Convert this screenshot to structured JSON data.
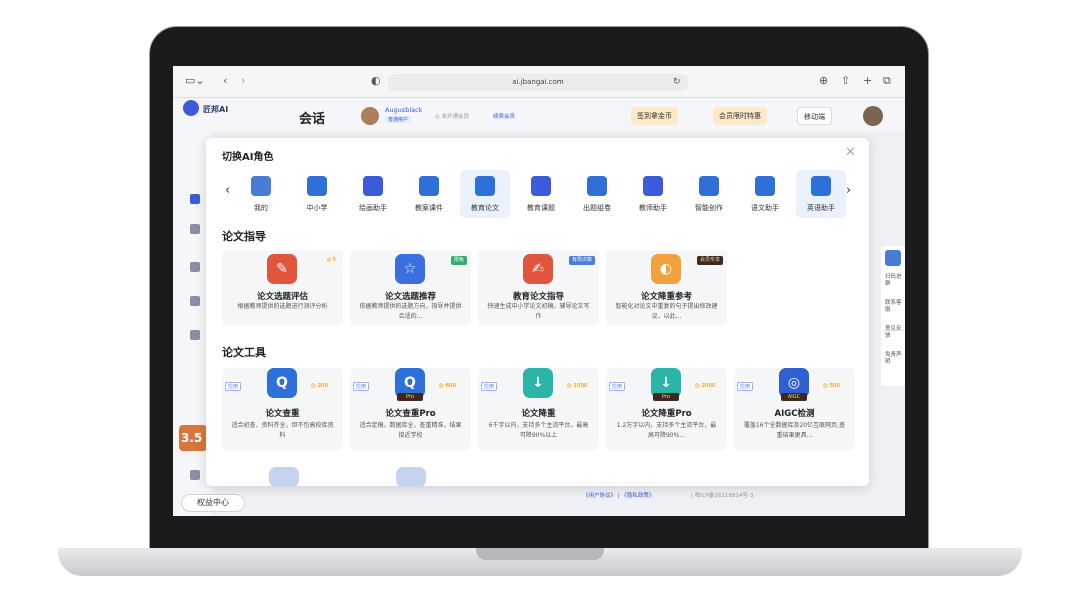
{
  "browser": {
    "url": "ai.jbangai.com"
  },
  "app": {
    "title": "会话",
    "user_name": "Augusblack",
    "user_badge": "普通用户",
    "vip_status": "◎ 未开通会员",
    "vip_link": "续费会员",
    "btn_sign": "签到拿金币",
    "btn_offer": "会员限时特惠",
    "btn_mobile": "移动端",
    "promo_text": "3.5",
    "benefit_center": "权益中心",
    "side_logo": "匠邦AI",
    "right_panel": [
      "扫码进群",
      "联系客服",
      "意见反馈",
      "免责声明"
    ],
    "footer_links": "《用户协议》 | 《隐私政策》",
    "footer_icp": "| 粤ICP备16118814号-3"
  },
  "modal": {
    "title": "切换AI角色",
    "roles": [
      {
        "label": "我的",
        "icon": "user-icon",
        "color": "#4a7bd5"
      },
      {
        "label": "中小学",
        "icon": "sprout-icon",
        "color": "#2f6fd8"
      },
      {
        "label": "绘画助手",
        "icon": "palette-icon",
        "color": "#3b5bdb"
      },
      {
        "label": "教案课件",
        "icon": "folder-icon",
        "color": "#2f6fd8"
      },
      {
        "label": "教育论文",
        "icon": "graduation-cap-icon",
        "color": "#2f6fd8",
        "active": true
      },
      {
        "label": "教育课题",
        "icon": "bar-chart-icon",
        "color": "#3b5bdb"
      },
      {
        "label": "出题组卷",
        "icon": "exam-paper-icon",
        "color": "#2f6fd8"
      },
      {
        "label": "教师助手",
        "icon": "teacher-icon",
        "color": "#3b5bdb"
      },
      {
        "label": "智能创作",
        "icon": "quill-icon",
        "color": "#2f6fd8"
      },
      {
        "label": "语文助手",
        "icon": "chinese-char-icon",
        "color": "#2f6fd8"
      },
      {
        "label": "英语助手",
        "icon": "letter-a-icon",
        "color": "#2f6fd8",
        "active": true
      }
    ],
    "section_guide": "论文指导",
    "guide_cards": [
      {
        "title": "论文选题评估",
        "desc": "根据教师提供的选题进行测评分析",
        "badge": "◎ 5",
        "badge_bg": "#fff7e6",
        "badge_fg": "#c0831a",
        "icon_glyph": "✎",
        "icon_color": "#e0553b"
      },
      {
        "title": "论文选题推荐",
        "desc": "依据教师提供的选题方向，指导并提供合适的...",
        "badge": "限免",
        "badge_bg": "#2fae6a",
        "badge_fg": "#ffffff",
        "icon_glyph": "☆",
        "icon_color": "#3b6fe0"
      },
      {
        "title": "教育论文指导",
        "desc": "快速生成中小学论文初稿，辅导论文写作",
        "badge": "有限次数",
        "badge_bg": "#4a7bd5",
        "badge_fg": "#ffffff",
        "icon_glyph": "✍",
        "icon_color": "#e0553b"
      },
      {
        "title": "论文降重参考",
        "desc": "智能化对论文中重复的句子提出修改建议，以此...",
        "badge": "会员专享",
        "badge_bg": "#3a2a20",
        "badge_fg": "#f5d3a0",
        "icon_glyph": "◐",
        "icon_color": "#f2a23c"
      }
    ],
    "section_tools": "论文工具",
    "tools": [
      {
        "title": "论文查重",
        "desc": "适合初查，资料齐全，但不包高校库资料",
        "tag": "应用",
        "cost": "◎ 200",
        "pro": "",
        "icon_glyph": "Q",
        "icon_color": "#2f6fd8"
      },
      {
        "title": "论文查重Pro",
        "desc": "适合定稿，数据库全，查重精准，结果接近学校",
        "tag": "应用",
        "cost": "◎ 600",
        "pro": "Pro",
        "icon_glyph": "Q",
        "icon_color": "#2f6fd8"
      },
      {
        "title": "论文降重",
        "desc": "6千字以内，支持多个主流平台，最高可降90%以上",
        "tag": "应用",
        "cost": "◎ 1000",
        "pro": "",
        "icon_glyph": "↓",
        "icon_color": "#2bb5a8"
      },
      {
        "title": "论文降重Pro",
        "desc": "1.2万字以内，支持多个主流平台，最高可降90%...",
        "tag": "应用",
        "cost": "◎ 2000",
        "pro": "Pro",
        "icon_glyph": "↓",
        "icon_color": "#2bb5a8"
      },
      {
        "title": "AIGC检测",
        "desc": "覆盖16个全数据库及20亿互联网页,查重结果更具...",
        "tag": "应用",
        "cost": "◎ 500",
        "pro": "AIGC",
        "icon_glyph": "◎",
        "icon_color": "#2f5fd0"
      }
    ]
  }
}
